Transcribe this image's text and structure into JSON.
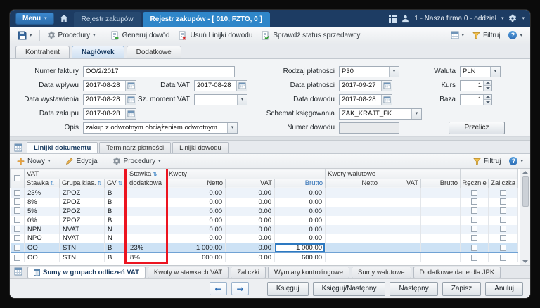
{
  "titlebar": {
    "menu": "Menu",
    "tab_registry": "Rejestr zakupów",
    "tab_document": "Rejestr zakupów - [ 010, FZTO, 0 ]",
    "company": "1 - Nasza firma 0 - oddział"
  },
  "toolbar": {
    "procedury": "Procedury",
    "generuj": "Generuj dowód",
    "usun": "Usuń Linijki dowodu",
    "sprawdz": "Sprawdź status sprzedawcy",
    "filtruj": "Filtruj"
  },
  "header_tabs": {
    "kontrahent": "Kontrahent",
    "naglowek": "Nagłówek",
    "dodatkowe": "Dodatkowe"
  },
  "form": {
    "numer_faktury": {
      "label": "Numer faktury",
      "value": "OO/2/2017"
    },
    "data_wplywu": {
      "label": "Data wpływu",
      "value": "2017-08-28"
    },
    "data_vat": {
      "label": "Data VAT",
      "value": "2017-08-28"
    },
    "data_wystawienia": {
      "label": "Data wystawienia",
      "value": "2017-08-28"
    },
    "sz_moment_vat": {
      "label": "Sz. moment VAT",
      "value": ""
    },
    "data_zakupu": {
      "label": "Data zakupu",
      "value": "2017-08-28"
    },
    "opis": {
      "label": "Opis",
      "value": "zakup z odwrotnym obciążeniem odwrotnym"
    },
    "rodzaj_platnosci": {
      "label": "Rodzaj płatności",
      "value": "P30"
    },
    "data_platnosci": {
      "label": "Data płatności",
      "value": "2017-09-27"
    },
    "data_dowodu": {
      "label": "Data dowodu",
      "value": "2017-08-28"
    },
    "schemat_ksiegowania": {
      "label": "Schemat księgowania",
      "value": "ZAK_KRAJT_FK"
    },
    "numer_dowodu": {
      "label": "Numer dowodu",
      "value": ""
    },
    "waluta": {
      "label": "Waluta",
      "value": "PLN"
    },
    "kurs": {
      "label": "Kurs",
      "value": "1"
    },
    "baza": {
      "label": "Baza",
      "value": "1"
    },
    "przelicz": "Przelicz"
  },
  "grid_tabs": {
    "linijki_dokumentu": "Linijki dokumentu",
    "terminarz": "Terminarz płatności",
    "linijki_dowodu": "Linijki dowodu"
  },
  "grid_toolbar": {
    "nowy": "Nowy",
    "edycja": "Edycja",
    "procedury": "Procedury",
    "filtruj": "Filtruj"
  },
  "table": {
    "groups": {
      "vat": "VAT",
      "kwoty": "Kwoty",
      "walutowe": "Kwoty walutowe"
    },
    "columns": {
      "stawka": "Stawka",
      "grupa": "Grupa klas.",
      "gv": "GV",
      "dodatkowa_1": "Stawka",
      "dodatkowa_2": "dodatkowa",
      "netto": "Netto",
      "vat": "VAT",
      "brutto": "Brutto",
      "w_netto": "Netto",
      "w_vat": "VAT",
      "w_brutto": "Brutto",
      "recznie": "Ręcznie",
      "zaliczka": "Zaliczka"
    },
    "rows": [
      {
        "stawka": "23%",
        "grupa": "ZPOZ",
        "gv": "B",
        "dodatkowa": "",
        "netto": "0.00",
        "vat": "0.00",
        "brutto": "0.00",
        "w_netto": "",
        "w_vat": "",
        "w_brutto": "",
        "selected": false,
        "edit": false
      },
      {
        "stawka": "8%",
        "grupa": "ZPOZ",
        "gv": "B",
        "dodatkowa": "",
        "netto": "0.00",
        "vat": "0.00",
        "brutto": "0.00",
        "w_netto": "",
        "w_vat": "",
        "w_brutto": "",
        "selected": false,
        "edit": false
      },
      {
        "stawka": "5%",
        "grupa": "ZPOZ",
        "gv": "B",
        "dodatkowa": "",
        "netto": "0.00",
        "vat": "0.00",
        "brutto": "0.00",
        "w_netto": "",
        "w_vat": "",
        "w_brutto": "",
        "selected": false,
        "edit": false
      },
      {
        "stawka": "0%",
        "grupa": "ZPOZ",
        "gv": "B",
        "dodatkowa": "",
        "netto": "0.00",
        "vat": "0.00",
        "brutto": "0.00",
        "w_netto": "",
        "w_vat": "",
        "w_brutto": "",
        "selected": false,
        "edit": false
      },
      {
        "stawka": "NPN",
        "grupa": "NVAT",
        "gv": "N",
        "dodatkowa": "",
        "netto": "0.00",
        "vat": "0.00",
        "brutto": "0.00",
        "w_netto": "",
        "w_vat": "",
        "w_brutto": "",
        "selected": false,
        "edit": false
      },
      {
        "stawka": "NPO",
        "grupa": "NVAT",
        "gv": "N",
        "dodatkowa": "",
        "netto": "0.00",
        "vat": "0.00",
        "brutto": "0.00",
        "w_netto": "",
        "w_vat": "",
        "w_brutto": "",
        "selected": false,
        "edit": false
      },
      {
        "stawka": "OO",
        "grupa": "STN",
        "gv": "B",
        "dodatkowa": "23%",
        "netto": "1 000.00",
        "vat": "0.00",
        "brutto": "1 000.00",
        "w_netto": "",
        "w_vat": "",
        "w_brutto": "",
        "selected": true,
        "edit": true
      },
      {
        "stawka": "OO",
        "grupa": "STN",
        "gv": "B",
        "dodatkowa": "8%",
        "netto": "600.00",
        "vat": "0.00",
        "brutto": "600.00",
        "w_netto": "",
        "w_vat": "",
        "w_brutto": "",
        "selected": false,
        "edit": false
      }
    ]
  },
  "bottom_tabs": [
    "Sumy w grupach odliczeń VAT",
    "Kwoty w stawkach VAT",
    "Zaliczki",
    "Wymiary kontrolingowe",
    "Sumy walutowe",
    "Dodatkowe dane dla JPK"
  ],
  "footer": {
    "ksieguj": "Księguj",
    "ksieguj_nastepny": "Księguj/Następny",
    "nastepny": "Następny",
    "zapisz": "Zapisz",
    "anuluj": "Anuluj"
  },
  "colors": {
    "accent": "#2f86c9",
    "titlebar": "#1d3c63",
    "highlight_red": "#ec1420"
  }
}
